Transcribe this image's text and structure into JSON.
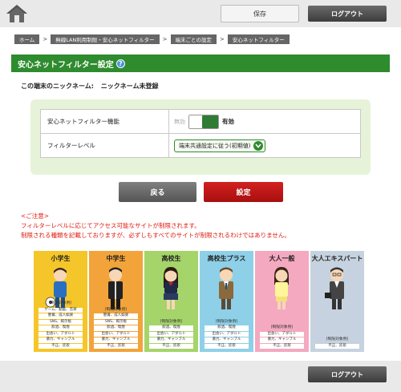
{
  "header": {
    "save_label": "保存",
    "logout_label": "ログアウト"
  },
  "breadcrumb": [
    {
      "label": "ホーム"
    },
    {
      "label": "無線LAN利用制限・安心ネットフィルター"
    },
    {
      "label": "端末ごとの設定"
    },
    {
      "label": "安心ネットフィルター"
    }
  ],
  "breadcrumb_separator": ">",
  "page": {
    "title": "安心ネットフィルター設定",
    "help_icon": "?"
  },
  "nickname": {
    "label": "この端末のニックネーム:",
    "value": "ニックネーム未登録"
  },
  "settings": {
    "filter_label": "安心ネットフィルター機能",
    "toggle_off": "無効",
    "toggle_on": "有効",
    "toggle_state": "on",
    "level_label": "フィルターレベル",
    "level_value": "端末共通設定に従う(初期値)"
  },
  "buttons": {
    "back": "戻る",
    "apply": "設定"
  },
  "notice": {
    "title": "<ご注意>",
    "line1": "フィルターレベルに応じてアクセス可能なサイトが制限されます。",
    "line2": "制限される種類を記載しておりますが、必ずしもすべてのサイトが制限されるわけではありません。"
  },
  "levels": [
    {
      "title": "小学生",
      "color": "#f5c62a",
      "items": [
        "(制限対象例)",
        "ゲーム、動画、音楽",
        "懸賞、成人娯楽",
        "SNS、掲示板",
        "飲酒、喫煙",
        "出会い、アダルト",
        "暴力、ギャンブル",
        "不正、詐欺"
      ]
    },
    {
      "title": "中学生",
      "color": "#f2a43a",
      "items": [
        "(制限対象例)",
        "懸賞、成人娯楽",
        "SNS、掲示板",
        "飲酒、喫煙",
        "出会い、アダルト",
        "暴力、ギャンブル",
        "不正、詐欺"
      ]
    },
    {
      "title": "高校生",
      "color": "#a5d46a",
      "items": [
        "(制限対象例)",
        "飲酒、喫煙",
        "出会い、アダルト",
        "暴力、ギャンブル",
        "不正、詐欺"
      ]
    },
    {
      "title": "高校生プラス",
      "color": "#8ed0e8",
      "items": [
        "(制限対象例)",
        "飲酒、喫煙",
        "出会い、アダルト",
        "暴力、ギャンブル",
        "不正、詐欺"
      ]
    },
    {
      "title": "大人一般",
      "color": "#f4a9c0",
      "items": [
        "(制限対象例)",
        "出会い、アダルト",
        "暴力、ギャンブル",
        "不正、詐欺"
      ]
    },
    {
      "title": "大人エキスパート",
      "color": "#c6d2df",
      "items": [
        "(制限対象例)",
        "不正、詐欺"
      ]
    }
  ]
}
